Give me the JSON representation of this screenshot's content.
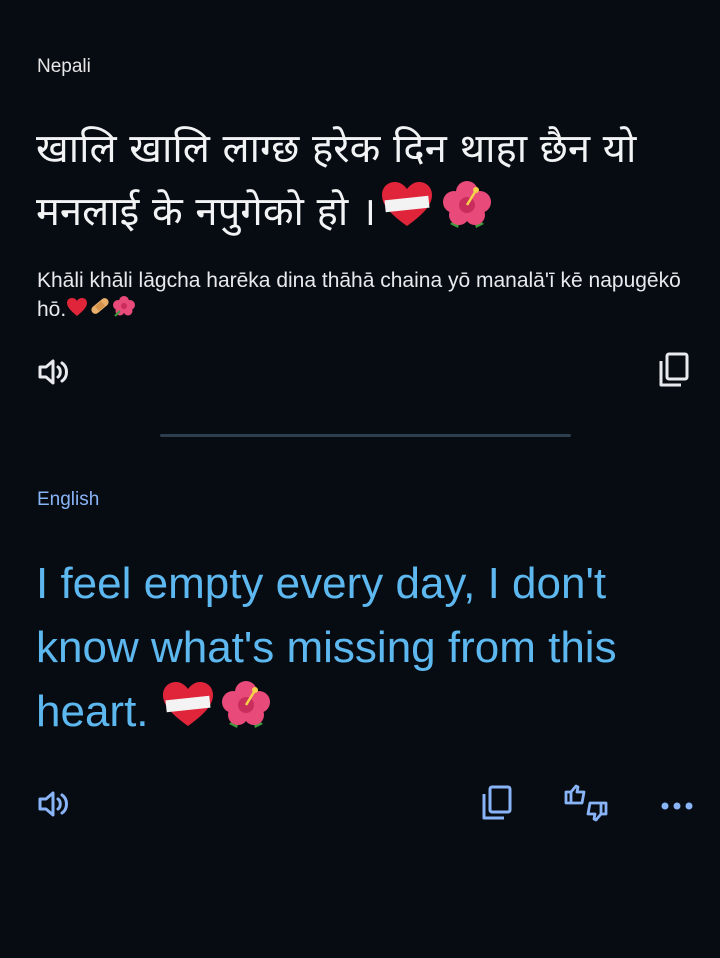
{
  "source": {
    "language": "Nepali",
    "text": "खालि खालि लाग्छ हरेक दिन थाहा छैन यो मनलाई के नपुगेको हो ।",
    "transliteration": "Khāli khāli lāgcha harēka dina thāhā chaina yō manalā'ī kē napugēkō hō.",
    "icons": [
      "speaker-icon",
      "copy-icon"
    ]
  },
  "target": {
    "language": "English",
    "text": "I feel empty every day, I don't know what's missing from this heart.",
    "icons": [
      "speaker-icon",
      "copy-icon",
      "feedback-icon",
      "more-icon"
    ]
  },
  "colors": {
    "background": "#070c12",
    "accent": "#8ab4f8",
    "translation_text": "#5eb8f0",
    "divider": "#2d3e4e"
  }
}
